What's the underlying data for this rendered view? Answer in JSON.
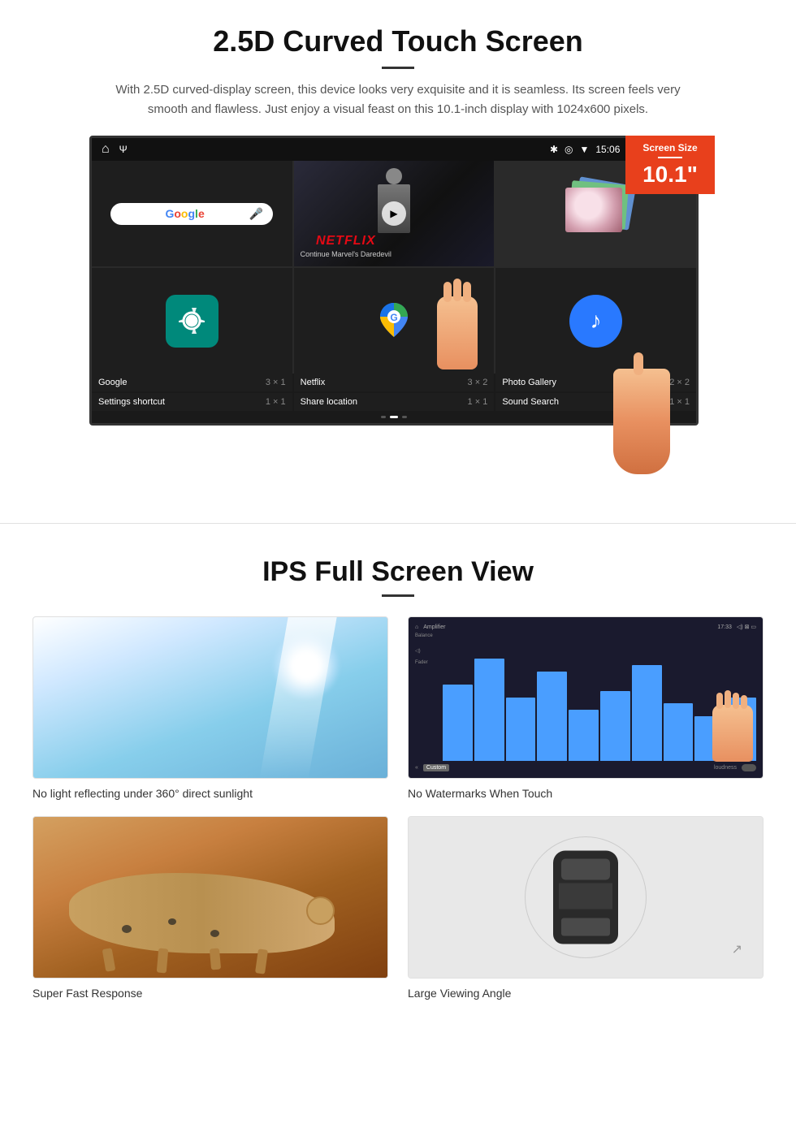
{
  "section1": {
    "title": "2.5D Curved Touch Screen",
    "description": "With 2.5D curved-display screen, this device looks very exquisite and it is seamless. Its screen feels very smooth and flawless. Just enjoy a visual feast on this 10.1-inch display with 1024x600 pixels.",
    "badge": {
      "label": "Screen Size",
      "size": "10.1\""
    },
    "status_bar": {
      "time": "15:06"
    },
    "apps": [
      {
        "name": "Google",
        "size": "3 × 1"
      },
      {
        "name": "Netflix",
        "size": "3 × 2"
      },
      {
        "name": "Photo Gallery",
        "size": "2 × 2"
      },
      {
        "name": "Settings shortcut",
        "size": "1 × 1"
      },
      {
        "name": "Share location",
        "size": "1 × 1"
      },
      {
        "name": "Sound Search",
        "size": "1 × 1"
      }
    ],
    "netflix": {
      "logo": "NETFLIX",
      "subtitle": "Continue Marvel's Daredevil"
    }
  },
  "section2": {
    "title": "IPS Full Screen View",
    "features": [
      {
        "id": "sunlight",
        "caption": "No light reflecting under 360° direct sunlight"
      },
      {
        "id": "watermarks",
        "caption": "No Watermarks When Touch"
      },
      {
        "id": "cheetah",
        "caption": "Super Fast Response"
      },
      {
        "id": "car",
        "caption": "Large Viewing Angle"
      }
    ]
  }
}
